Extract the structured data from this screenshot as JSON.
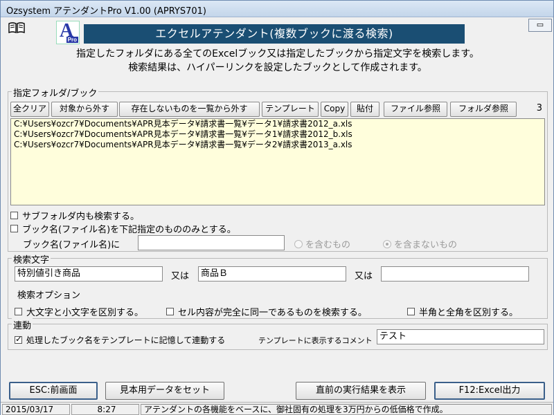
{
  "window": {
    "title": "Ozsystem アテンダントPro V1.00 (APRYS701)",
    "restore_button": "▭"
  },
  "header": {
    "banner": "エクセルアテンダント(複数ブックに渡る検索)",
    "logo_letter": "A",
    "logo_sub": "Pro",
    "desc_line1": "指定したフォルダにある全てのExcelブック又は指定したブックから指定文字を検索します。",
    "desc_line2": "検索結果は、ハイパーリンクを設定したブックとして作成されます。"
  },
  "folder_group": {
    "label": "指定フォルダ/ブック",
    "buttons": {
      "clear_all": "全クリア",
      "remove": "対象から外す",
      "remove_missing": "存在しないものを一覧から外す",
      "template": "テンプレート",
      "copy": "Copy",
      "paste": "貼付",
      "file_ref": "ファイル参照",
      "folder_ref": "フォルダ参照"
    },
    "count": "3",
    "files": [
      "C:¥Users¥ozcr7¥Documents¥APR見本データ¥請求書一覧¥データ1¥請求書2012_a.xls",
      "C:¥Users¥ozcr7¥Documents¥APR見本データ¥請求書一覧¥データ1¥請求書2012_b.xls",
      "C:¥Users¥ozcr7¥Documents¥APR見本データ¥請求書一覧¥データ2¥請求書2013_a.xls"
    ],
    "subfolder_check": "サブフォルダ内も検索する。",
    "bookname_check": "ブック名(ファイル名)を下記指定のもののみとする。",
    "bookname_label": "ブック名(ファイル名)に",
    "bookname_value": "",
    "radio_include": "を含むもの",
    "radio_exclude": "を含まないもの"
  },
  "search_group": {
    "label": "検索文字",
    "term1": "特別値引き商品",
    "or1": "又は",
    "term2": "商品Ｂ",
    "or2": "又は",
    "term3": "",
    "options_label": "検索オプション",
    "opt_case": "大文字と小文字を区別する。",
    "opt_exact": "セル内容が完全に同一であるものを検索する。",
    "opt_width": "半角と全角を区別する。"
  },
  "link_group": {
    "label": "連動",
    "remember_check": "処理したブック名をテンプレートに記憶して連動する",
    "comment_label": "テンプレートに表示するコメント",
    "comment_value": "テスト"
  },
  "footer": {
    "esc": "ESC:前画面",
    "sample": "見本用データをセット",
    "show_prev": "直前の実行結果を表示",
    "f12": "F12:Excel出力"
  },
  "status": {
    "date": "2015/03/17",
    "time": "8:27",
    "message": "アテンダントの各機能をベースに、御社固有の処理を3万円からの低価格で作成。"
  },
  "icons": {
    "book": "book-icon",
    "logo": "app-logo-icon"
  }
}
